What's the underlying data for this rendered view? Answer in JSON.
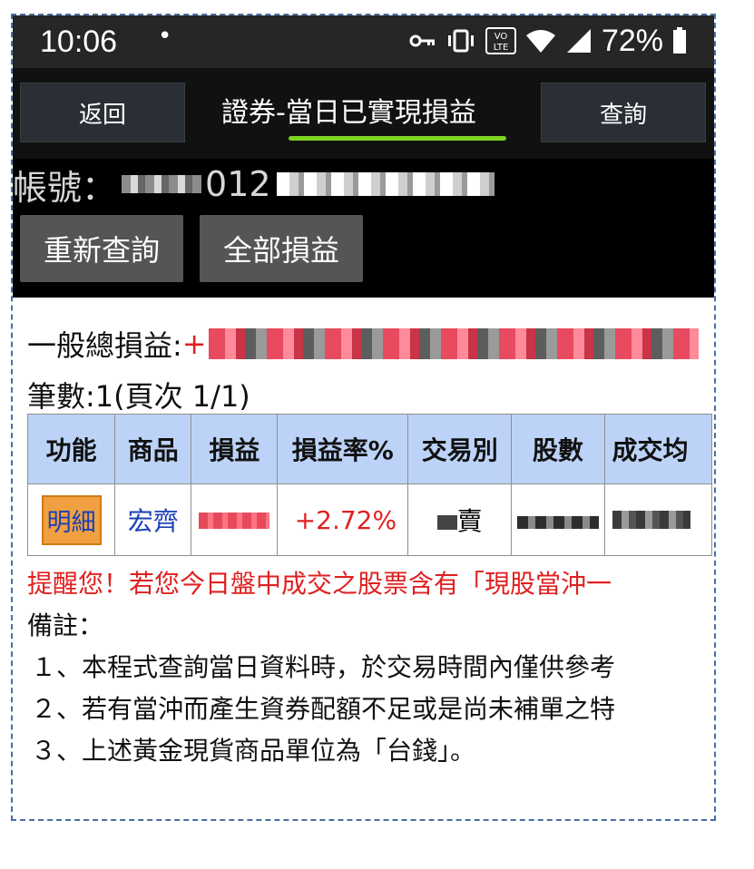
{
  "status_bar": {
    "time": "10:06",
    "dot": "•",
    "battery": "72%",
    "lte_label": "VO\nLTE"
  },
  "nav": {
    "back_label": "返回",
    "title_prefix": "證券-",
    "title_main": "當日已實現損益",
    "query_label": "查詢"
  },
  "account": {
    "label": "帳號：",
    "visible_digits": "012"
  },
  "actions": {
    "requery_label": "重新查詢",
    "all_pl_label": "全部損益"
  },
  "summary": {
    "total_label": "一般總損益:",
    "total_sign": "+",
    "count_text": "筆數:1(頁次 1/1)"
  },
  "table": {
    "headers": [
      "功能",
      "商品",
      "損益",
      "損益率%",
      "交易別",
      "股數",
      "成交均"
    ],
    "rows": [
      {
        "function": "明細",
        "product": "宏齊",
        "rate": "+2.72%",
        "side_suffix": "賣"
      }
    ]
  },
  "reminder": "提醒您！若您今日盤中成交之股票含有「現股當沖一",
  "notes": {
    "title": "備註：",
    "items": [
      "１、本程式查詢當日資料時，於交易時間內僅供參考",
      "２、若有當沖而產生資券配額不足或是尚未補單之特",
      "３、上述黃金現貨商品單位為「台錢」。"
    ]
  },
  "colors": {
    "accent_underline": "#7ed321",
    "header_bg": "#bcd3f7",
    "profit_red": "#e02020",
    "link_blue": "#1a3fb8",
    "detail_button": "#f0a040"
  }
}
